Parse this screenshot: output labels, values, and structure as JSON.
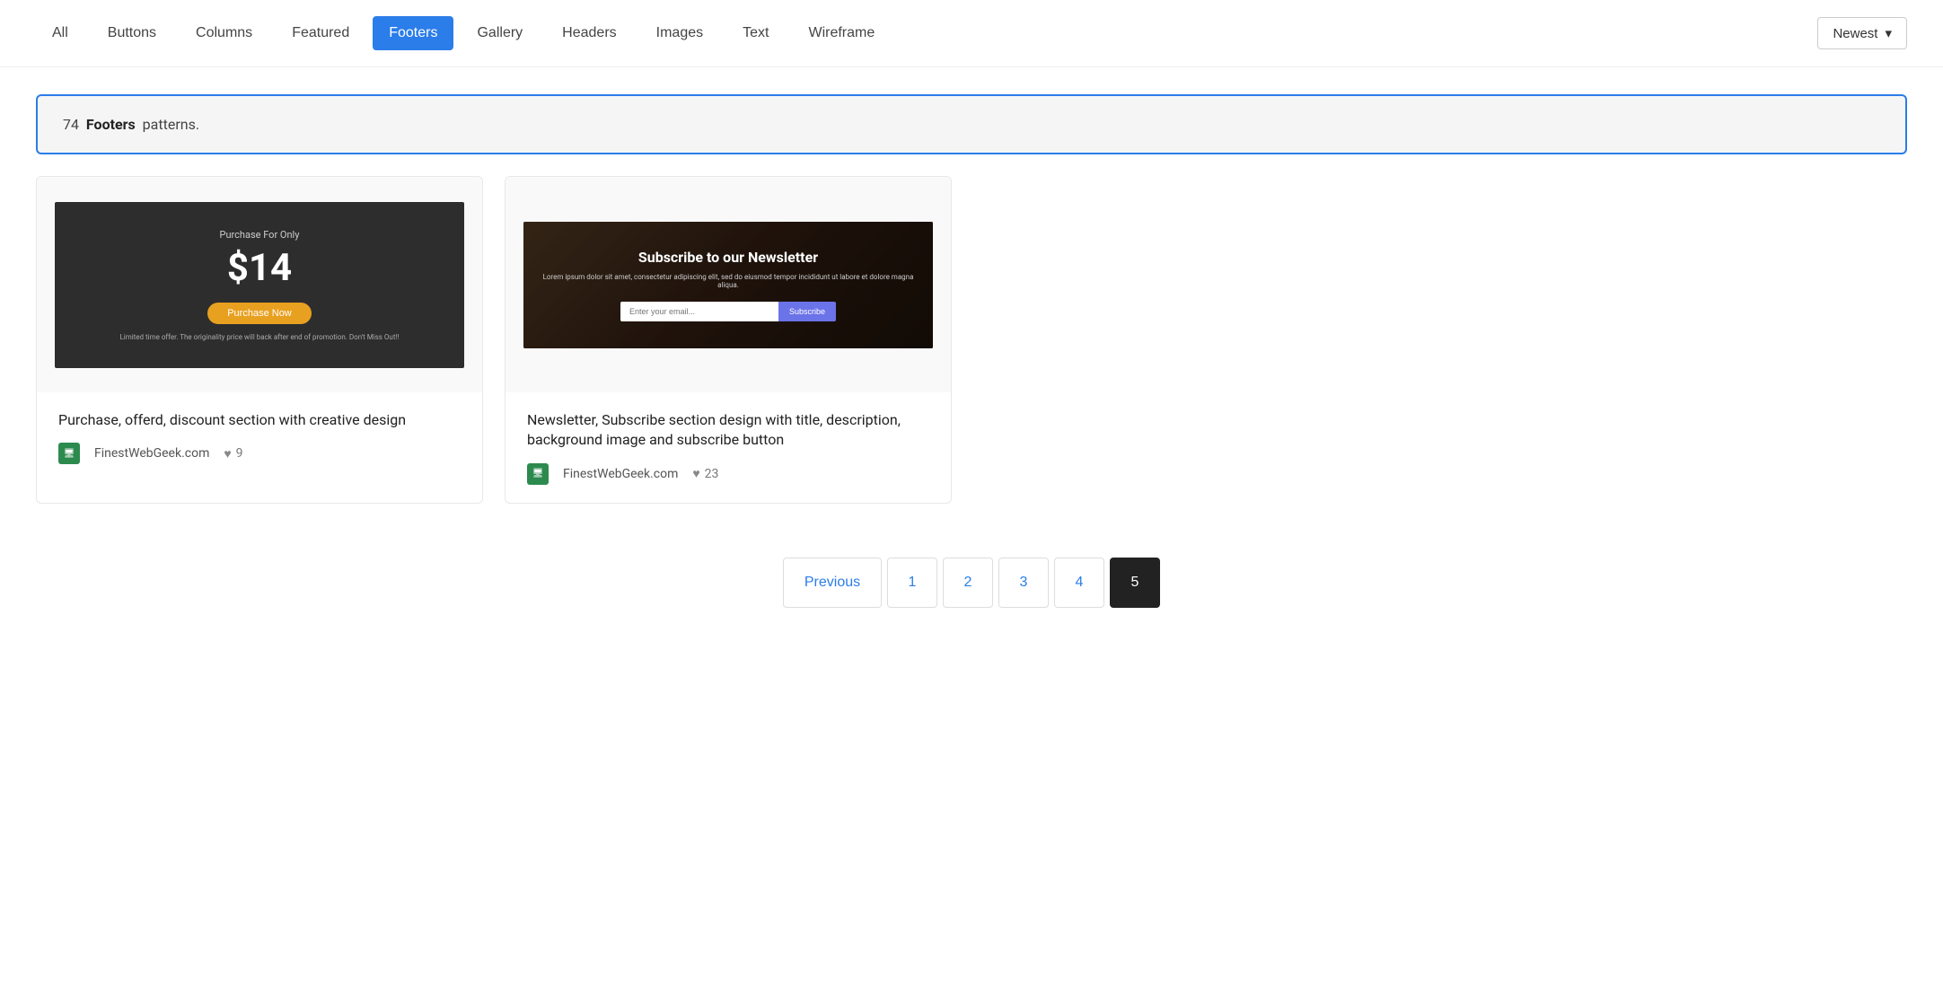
{
  "nav": {
    "tabs": [
      {
        "label": "All",
        "active": false
      },
      {
        "label": "Buttons",
        "active": false
      },
      {
        "label": "Columns",
        "active": false
      },
      {
        "label": "Featured",
        "active": false
      },
      {
        "label": "Footers",
        "active": true
      },
      {
        "label": "Gallery",
        "active": false
      },
      {
        "label": "Headers",
        "active": false
      },
      {
        "label": "Images",
        "active": false
      },
      {
        "label": "Text",
        "active": false
      },
      {
        "label": "Wireframe",
        "active": false
      }
    ],
    "sort_label": "Newest",
    "sort_icon": "▾"
  },
  "info": {
    "count": "74",
    "category": "Footers",
    "suffix": "patterns."
  },
  "cards": [
    {
      "id": "card-1",
      "preview_type": "purchase",
      "preview_sub": "Purchase For Only",
      "preview_price": "$14",
      "preview_btn": "Purchase Now",
      "preview_fine": "Limited time offer. The originality price will back after end of promotion. Don't Miss Out!!",
      "title": "Purchase, offerd, discount section with creative design",
      "author": "FinestWebGeek.com",
      "author_icon": "🖥",
      "likes": "9"
    },
    {
      "id": "card-2",
      "preview_type": "newsletter",
      "preview_heading": "Subscribe to our Newsletter",
      "preview_desc": "Lorem ipsum dolor sit amet, consectetur adipiscing elit, sed do eiusmod tempor incididunt ut labore et dolore magna aliqua.",
      "preview_input_placeholder": "Enter your email...",
      "preview_subscribe_btn": "Subscribe",
      "title": "Newsletter, Subscribe section design with title, description, background image and subscribe button",
      "author": "FinestWebGeek.com",
      "author_icon": "🖥",
      "likes": "23"
    }
  ],
  "pagination": {
    "prev_label": "Previous",
    "pages": [
      "1",
      "2",
      "3",
      "4",
      "5"
    ],
    "current_page": "5"
  }
}
